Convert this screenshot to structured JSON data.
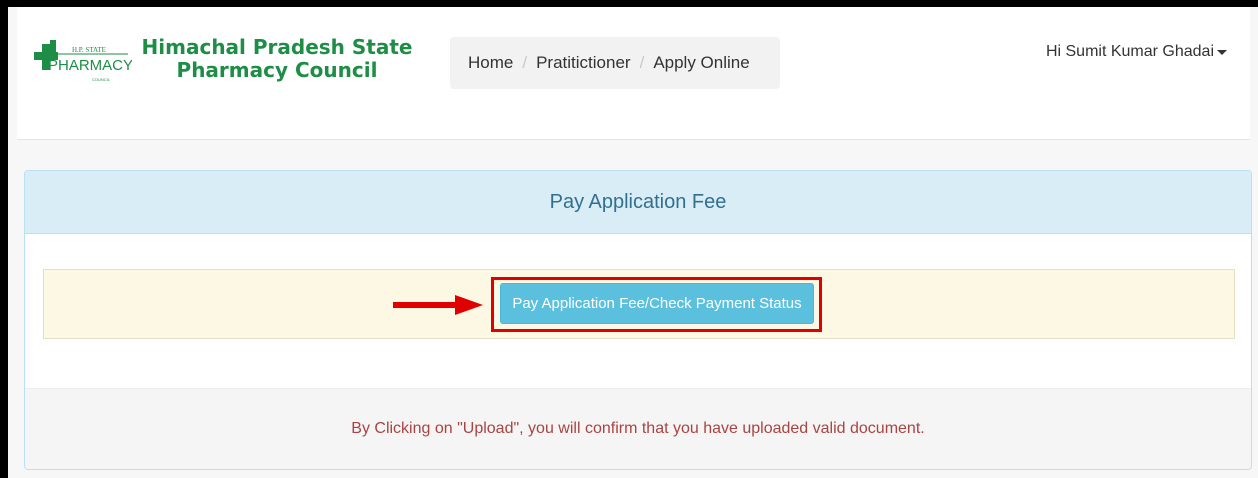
{
  "header": {
    "logo": {
      "title_line1": "Himachal Pradesh State",
      "title_line2": "Pharmacy Council",
      "mark_text_small": "H.P. STATE",
      "mark_text_main": "PHARMACY",
      "mark_text_council": "COUNCIL",
      "brand_color": "#1e8e46"
    },
    "breadcrumb": [
      "Home",
      "Pratitictioner",
      "Apply Online"
    ],
    "breadcrumb_separator": "/",
    "user_menu_label": "Hi Sumit Kumar Ghadai"
  },
  "panel": {
    "heading": "Pay Application Fee",
    "pay_button_label": "Pay Application Fee/Check Payment Status",
    "footer_note": "By Clicking on \"Upload\", you will confirm that you have uploaded valid document."
  },
  "colors": {
    "heading_bg": "#d9edf7",
    "button_bg": "#5bc0de",
    "highlight_border": "#e00000",
    "footer_text": "#a94442",
    "warning_bg": "#fcf8e3"
  },
  "icons": {
    "annotation_arrow": "right-arrow-icon",
    "user_caret": "caret-down-icon"
  }
}
